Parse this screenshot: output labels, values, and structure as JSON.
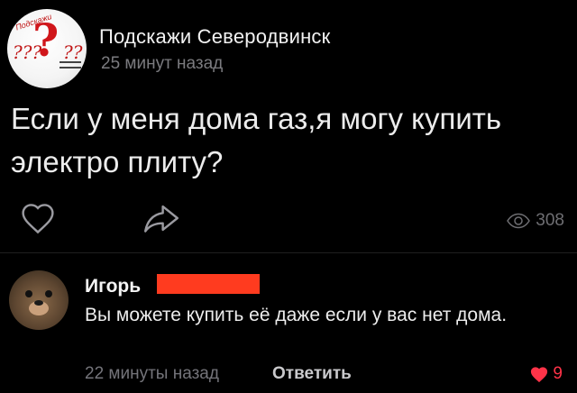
{
  "post": {
    "group_name": "Подскажи Северодвинск",
    "time": "25 минут назад",
    "text": "Если у меня дома газ,я могу купить электро плиту?",
    "views": "308",
    "avatar_text": {
      "banner": "Подскажи",
      "mark": "?",
      "left": "???",
      "right": "??"
    }
  },
  "comment": {
    "author": "Игорь",
    "text": "Вы можете купить её даже если у вас нет дома.",
    "time": "22 минуты назад",
    "reply_label": "Ответить",
    "likes": "9"
  },
  "colors": {
    "background": "#000000",
    "muted_text": "#7b7b7f",
    "like_red": "#ff3348",
    "redaction": "#ff3b1f"
  },
  "icons": {
    "like": "heart-outline-icon",
    "share": "share-arrow-icon",
    "views": "eye-icon",
    "comment_like": "heart-filled-icon"
  }
}
